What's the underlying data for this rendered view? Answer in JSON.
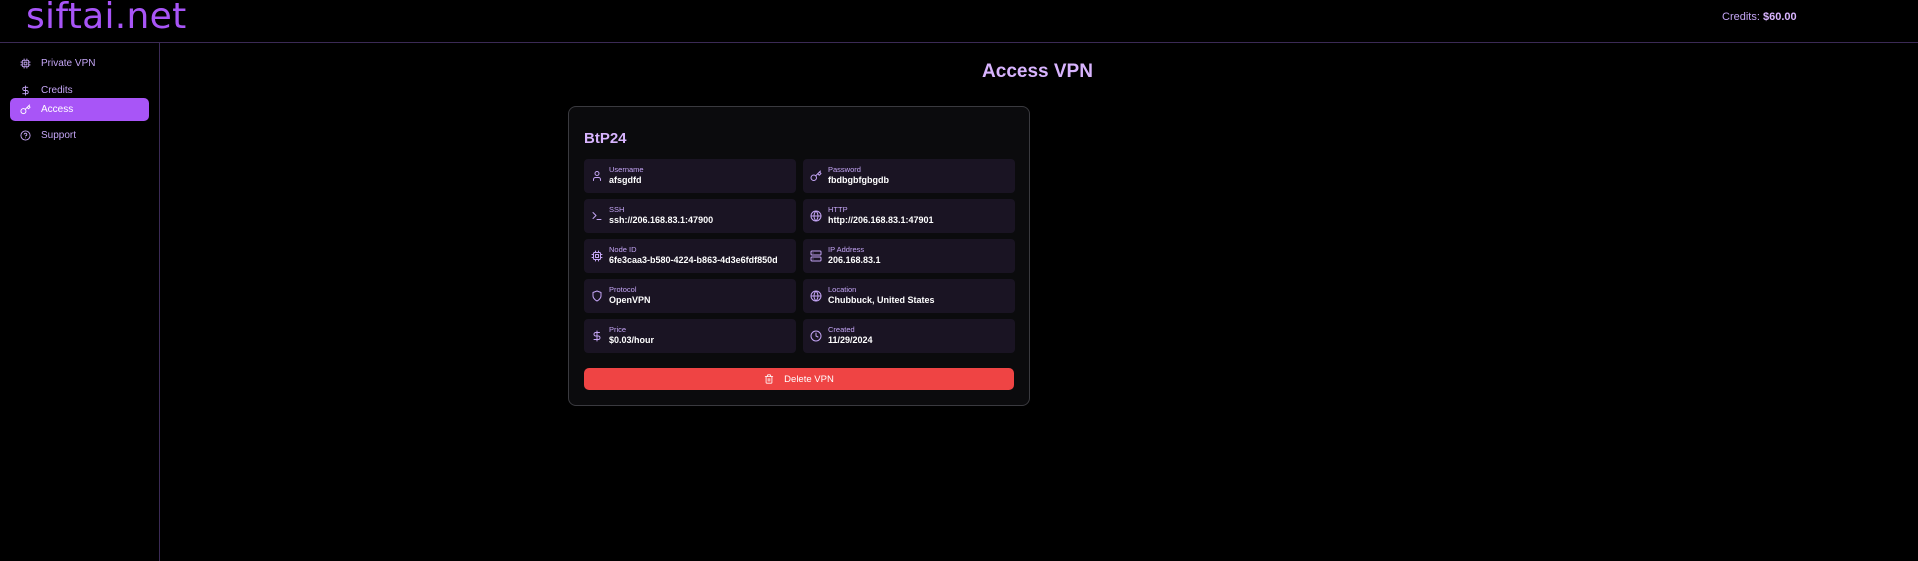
{
  "app": {
    "logo": "siftai.net",
    "credits_label": "Credits:",
    "credits_value": "$60.00"
  },
  "sidebar": {
    "items": [
      {
        "label": "Private VPN",
        "icon": "cpu-icon",
        "active": false
      },
      {
        "label": "Credits",
        "icon": "dollar-icon",
        "active": false
      },
      {
        "label": "Access",
        "icon": "key-icon",
        "active": true
      },
      {
        "label": "Support",
        "icon": "help-circle-icon",
        "active": false
      }
    ]
  },
  "main": {
    "title": "Access VPN",
    "card": {
      "name": "BtP24",
      "fields": [
        {
          "label": "Username",
          "value": "afsgdfd",
          "icon": "user-icon"
        },
        {
          "label": "Password",
          "value": "fbdbgbfgbgdb",
          "icon": "key-icon"
        },
        {
          "label": "SSH",
          "value": "ssh://206.168.83.1:47900",
          "icon": "terminal-icon"
        },
        {
          "label": "HTTP",
          "value": "http://206.168.83.1:47901",
          "icon": "globe-icon"
        },
        {
          "label": "Node ID",
          "value": "6fe3caa3-b580-4224-b863-4d3e6fdf850d",
          "icon": "cpu-icon"
        },
        {
          "label": "IP Address",
          "value": "206.168.83.1",
          "icon": "server-icon"
        },
        {
          "label": "Protocol",
          "value": "OpenVPN",
          "icon": "shield-icon"
        },
        {
          "label": "Location",
          "value": "Chubbuck, United States",
          "icon": "globe-icon"
        },
        {
          "label": "Price",
          "value": "$0.03/hour",
          "icon": "dollar-icon"
        },
        {
          "label": "Created",
          "value": "11/29/2024",
          "icon": "clock-icon"
        }
      ],
      "delete_label": "Delete VPN"
    }
  },
  "colors": {
    "accent": "#a855f7",
    "accent_light": "#d8b4fe",
    "danger": "#ef4444",
    "field_bg": "#1a1423",
    "card_bg": "#0b0b0d"
  }
}
